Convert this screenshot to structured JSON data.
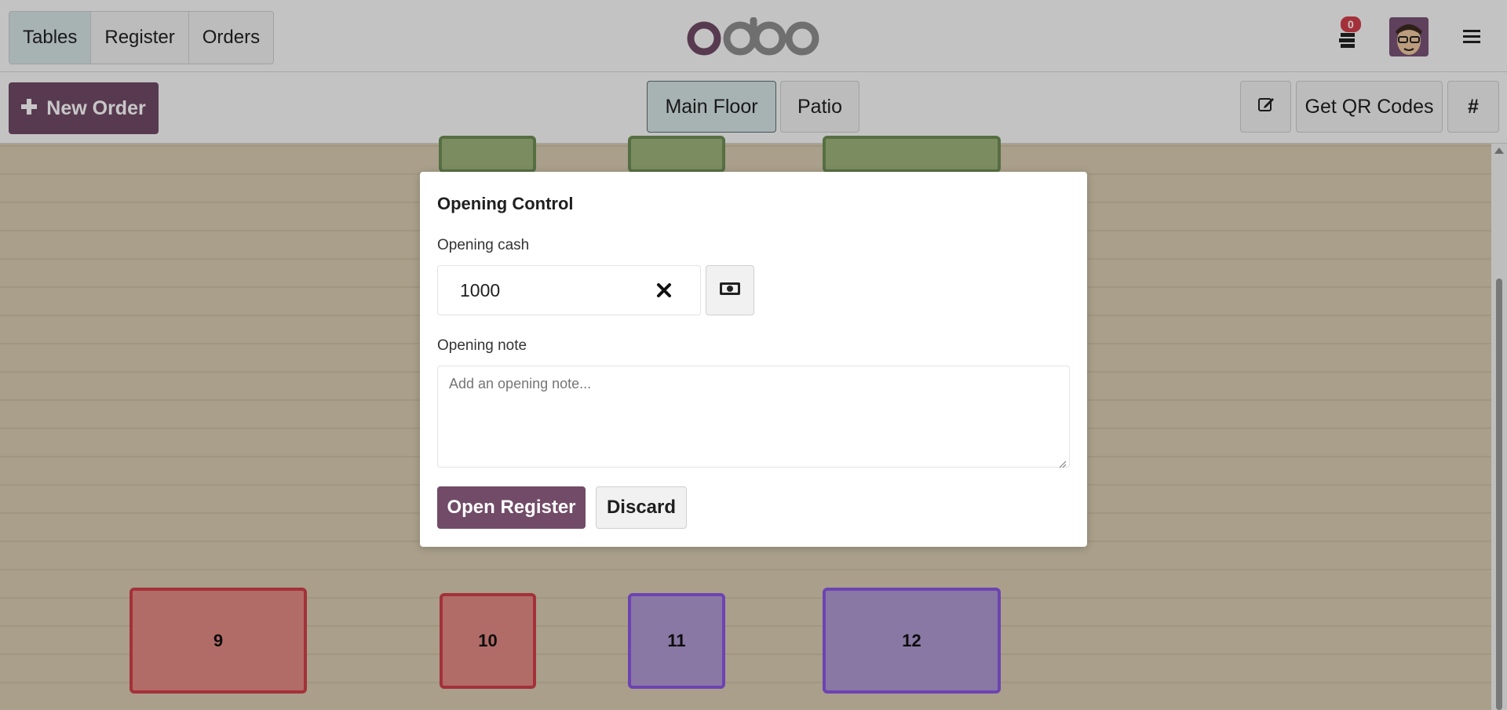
{
  "nav": {
    "tabs": [
      {
        "label": "Tables",
        "active": true
      },
      {
        "label": "Register",
        "active": false
      },
      {
        "label": "Orders",
        "active": false
      }
    ],
    "logo_icon": "odoo-logo",
    "cash_badge": "0",
    "avatar_icon": "user-avatar",
    "menu_icon": "hamburger-icon"
  },
  "toolbar": {
    "new_order_label": "New Order",
    "floors": [
      {
        "label": "Main Floor",
        "active": true
      },
      {
        "label": "Patio",
        "active": false
      }
    ],
    "edit_icon": "edit-icon",
    "qr_label": "Get QR Codes",
    "hash_label": "#"
  },
  "tables": [
    {
      "label": "9",
      "color": "red"
    },
    {
      "label": "10",
      "color": "red"
    },
    {
      "label": "11",
      "color": "purple"
    },
    {
      "label": "12",
      "color": "purple"
    }
  ],
  "modal": {
    "title": "Opening Control",
    "cash_label": "Opening cash",
    "cash_value": "1000",
    "note_label": "Opening note",
    "note_placeholder": "Add an opening note...",
    "open_label": "Open Register",
    "discard_label": "Discard"
  },
  "colors": {
    "brand": "#714b67",
    "active_tab": "#d7e4e6",
    "table_red": "#d23f4b",
    "table_purple": "#8c57e6"
  }
}
